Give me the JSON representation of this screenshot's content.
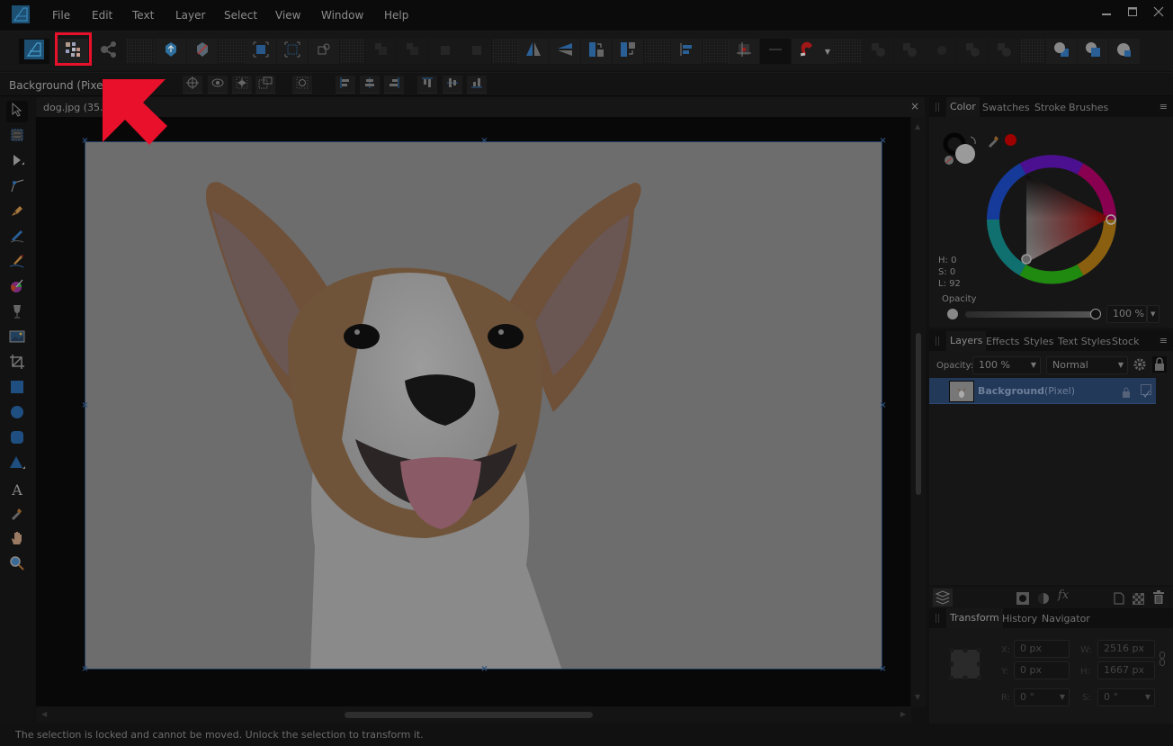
{
  "menu": [
    "File",
    "Edit",
    "Text",
    "Layer",
    "Select",
    "View",
    "Window",
    "Help"
  ],
  "window_controls": {
    "minimize": "minimize-icon",
    "maximize": "maximize-icon",
    "close": "close-icon"
  },
  "toolbar": {
    "personas": [
      "photo-persona-icon",
      "pixel-persona-icon",
      "export-persona-icon"
    ],
    "highlighted_button": "pixel-persona-icon",
    "groups": [
      [
        "assistant-icon",
        "no-assistant-icon"
      ],
      [
        "quick-mask-select-icon",
        "refine-selection-icon",
        "transform-selection-icon"
      ],
      [
        "arrange-back-icon",
        "arrange-backward-icon",
        "arrange-forward-icon",
        "arrange-front-icon"
      ],
      [
        "flip-horizontal-icon",
        "flip-vertical-icon",
        "rotate-left-icon",
        "rotate-right-icon"
      ],
      [
        "align-icon"
      ],
      [
        "snapping-grid-icon",
        "snapping-disabled-icon",
        "snapping-magnet-icon"
      ],
      [
        "add-icon",
        "subtract-icon",
        "intersect-icon",
        "divide-icon",
        "combine-icon"
      ],
      [
        "insert-behind-icon",
        "insert-inside-icon",
        "insert-top-icon"
      ]
    ]
  },
  "context": {
    "label": "Background (Pixel)",
    "buttons": [
      "target-icon",
      "eye-icon",
      "mirror-icon",
      "transform-icon",
      "rotate-icon",
      "align-left-icon",
      "align-center-icon",
      "align-right-icon",
      "align-top-icon",
      "align-middle-icon",
      "align-bottom-icon"
    ]
  },
  "tools": [
    "move-tool",
    "artboard-tool",
    "node-tool",
    "point-transform-tool",
    "pen-tool",
    "pencil-tool",
    "vector-brush-tool",
    "fill-tool",
    "transparency-tool",
    "place-image-tool",
    "crop-tool",
    "rectangle-tool",
    "ellipse-tool",
    "rounded-rectangle-tool",
    "triangle-tool",
    "text-tool",
    "color-picker-tool",
    "hand-tool",
    "zoom-tool"
  ],
  "document": {
    "tab_label": "dog.jpg (35.2%)",
    "close_label": "×"
  },
  "color_panel": {
    "tabs": [
      "Color",
      "Swatches",
      "Stroke",
      "Brushes"
    ],
    "active_tab": "Color",
    "hsl": {
      "h": "H: 0",
      "s": "S: 0",
      "l": "L: 92"
    },
    "opacity_label": "Opacity",
    "opacity_value": "100 %",
    "opacity_fraction": 1.0,
    "accent_color": "#b00000"
  },
  "layers_panel": {
    "tabs": [
      "Layers",
      "Effects",
      "Styles",
      "Text Styles",
      "Stock"
    ],
    "active_tab": "Layers",
    "opacity_label": "Opacity:",
    "opacity_value": "100 %",
    "blend_mode": "Normal",
    "layers": [
      {
        "name": "Background",
        "type": "(Pixel)",
        "selected": true,
        "locked": true,
        "visible": true
      }
    ],
    "footer_icons": [
      "layers-stack-icon",
      "mask-icon",
      "adjustment-icon",
      "fx-icon",
      "new-layer-icon",
      "pixel-layer-icon",
      "trash-icon"
    ]
  },
  "transform_panel": {
    "tabs": [
      "Transform",
      "History",
      "Navigator"
    ],
    "active_tab": "Transform",
    "x_label": "X:",
    "x": "0 px",
    "y_label": "Y:",
    "y": "0 px",
    "w_label": "W:",
    "w": "2516 px",
    "h_label": "H:",
    "h": "1667 px",
    "r_label": "R:",
    "r": "0 °",
    "s_label": "S:",
    "s": "0 °"
  },
  "status": "The selection is locked and cannot be moved. Unlock the selection to transform it.",
  "colors": {
    "accent_blue": "#1f5a8f",
    "highlight_red": "#e8102a",
    "selected_layer": "#23395a"
  }
}
